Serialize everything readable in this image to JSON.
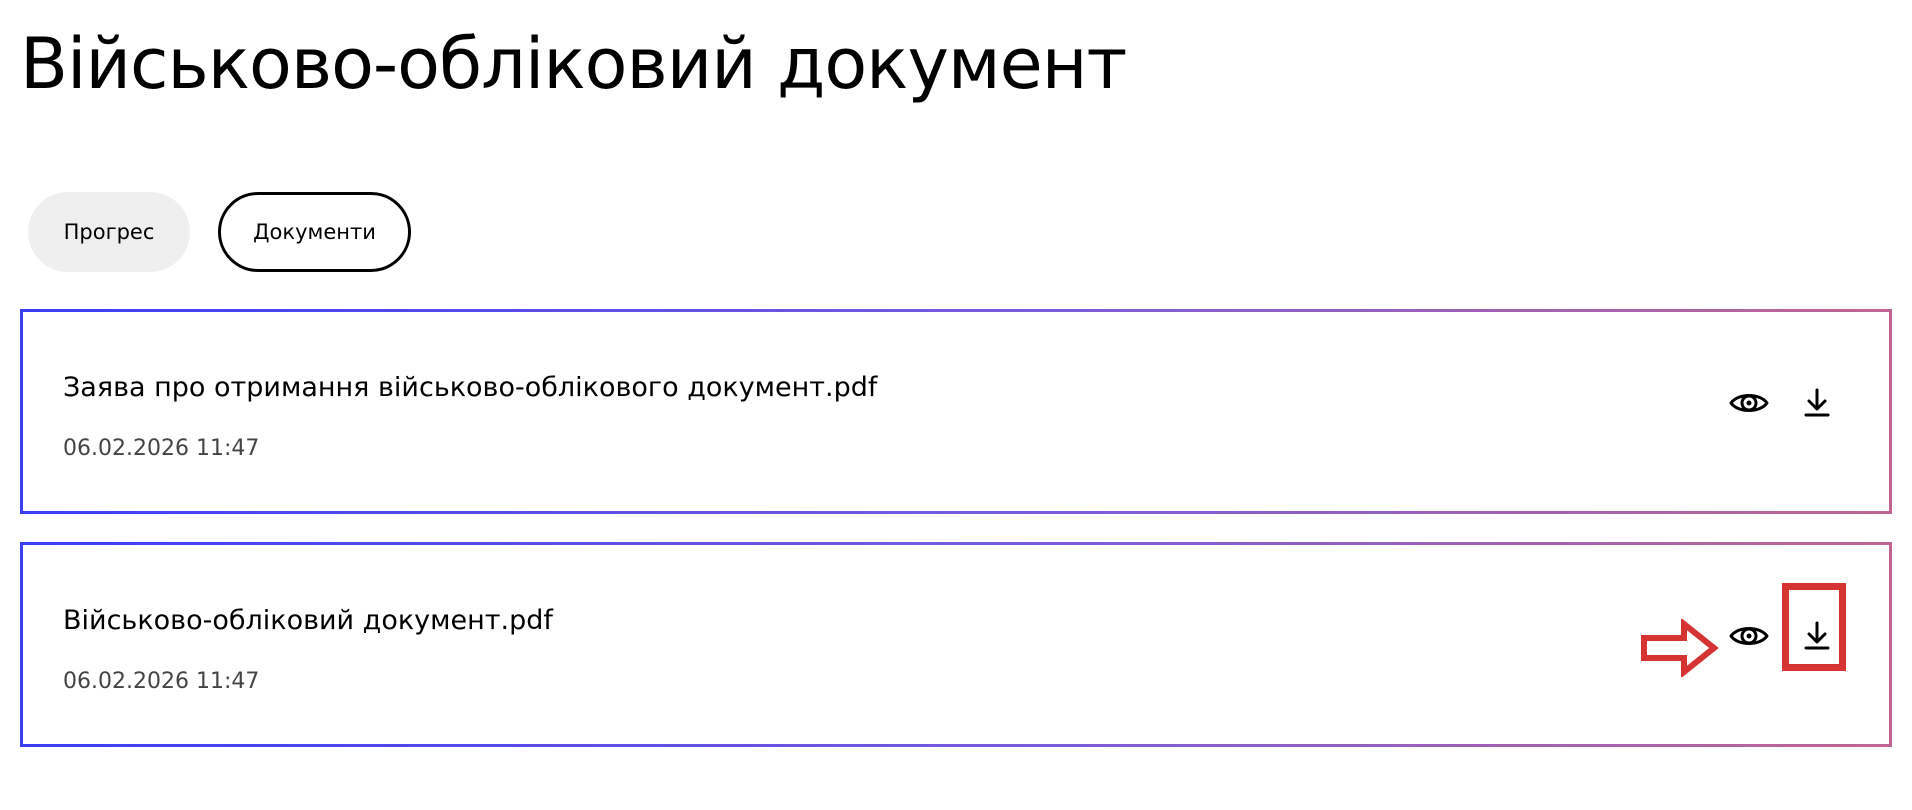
{
  "page": {
    "title": "Військово-обліковий документ"
  },
  "tabs": [
    {
      "label": "Прогрес",
      "active": false
    },
    {
      "label": "Документи",
      "active": true
    }
  ],
  "documents": [
    {
      "name": "Заява про отримання військово-облікового документ.pdf",
      "date": "06.02.2026 11:47",
      "view_icon": "eye-icon",
      "download_icon": "download-icon"
    },
    {
      "name": "Військово-обліковий документ.pdf",
      "date": "06.02.2026 11:47",
      "view_icon": "eye-icon",
      "download_icon": "download-icon",
      "highlighted_action": "download"
    }
  ],
  "colors": {
    "card_border_gradient_start": "#3a3ef5",
    "card_border_gradient_end": "#c06591",
    "active_tab_border": "#000000",
    "inactive_tab_bg": "#efefef",
    "annotation_red": "#d63433"
  }
}
